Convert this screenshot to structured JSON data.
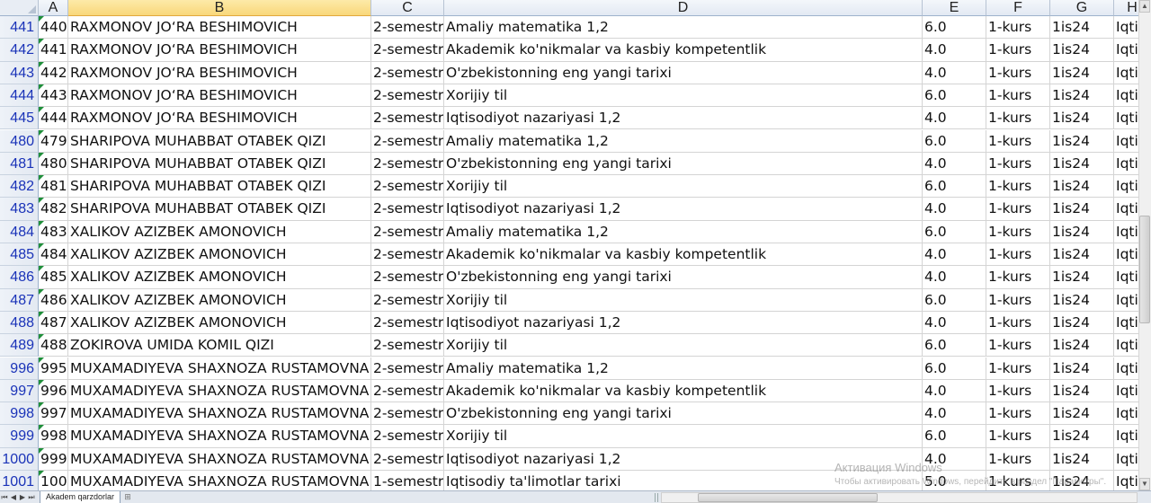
{
  "columns": [
    "A",
    "B",
    "C",
    "D",
    "E",
    "F",
    "G",
    "H"
  ],
  "selected_column": "B",
  "rows": [
    {
      "row": "441",
      "a": "440",
      "b": "RAXMONOV JO‘RA BESHIMOVICH",
      "c": "2-semestr",
      "d": "Amaliy matematika 1,2",
      "e": "6.0",
      "f": "1-kurs",
      "g": "1is24",
      "h": "Iqti"
    },
    {
      "row": "442",
      "a": "441",
      "b": "RAXMONOV JO‘RA BESHIMOVICH",
      "c": "2-semestr",
      "d": "Akademik ko'nikmalar va kasbiy kompetentlik",
      "e": "4.0",
      "f": "1-kurs",
      "g": "1is24",
      "h": "Iqti"
    },
    {
      "row": "443",
      "a": "442",
      "b": "RAXMONOV JO‘RA BESHIMOVICH",
      "c": "2-semestr",
      "d": "O'zbekistonning eng yangi tarixi",
      "e": "4.0",
      "f": "1-kurs",
      "g": "1is24",
      "h": "Iqti"
    },
    {
      "row": "444",
      "a": "443",
      "b": "RAXMONOV JO‘RA BESHIMOVICH",
      "c": "2-semestr",
      "d": "Xorijiy til",
      "e": "6.0",
      "f": "1-kurs",
      "g": "1is24",
      "h": "Iqti"
    },
    {
      "row": "445",
      "a": "444",
      "b": "RAXMONOV JO‘RA BESHIMOVICH",
      "c": "2-semestr",
      "d": "Iqtisodiyot nazariyasi 1,2",
      "e": "4.0",
      "f": "1-kurs",
      "g": "1is24",
      "h": "Iqti"
    },
    {
      "row": "480",
      "a": "479",
      "b": "SHARIPOVA MUHABBAT OTABEK QIZI",
      "c": "2-semestr",
      "d": "Amaliy matematika 1,2",
      "e": "6.0",
      "f": "1-kurs",
      "g": "1is24",
      "h": "Iqti"
    },
    {
      "row": "481",
      "a": "480",
      "b": "SHARIPOVA MUHABBAT OTABEK QIZI",
      "c": "2-semestr",
      "d": "O'zbekistonning eng yangi tarixi",
      "e": "4.0",
      "f": "1-kurs",
      "g": "1is24",
      "h": "Iqti"
    },
    {
      "row": "482",
      "a": "481",
      "b": "SHARIPOVA MUHABBAT OTABEK QIZI",
      "c": "2-semestr",
      "d": "Xorijiy til",
      "e": "6.0",
      "f": "1-kurs",
      "g": "1is24",
      "h": "Iqti"
    },
    {
      "row": "483",
      "a": "482",
      "b": "SHARIPOVA MUHABBAT OTABEK QIZI",
      "c": "2-semestr",
      "d": "Iqtisodiyot nazariyasi 1,2",
      "e": "4.0",
      "f": "1-kurs",
      "g": "1is24",
      "h": "Iqti"
    },
    {
      "row": "484",
      "a": "483",
      "b": "XALIKOV AZIZBEK AMONOVICH",
      "c": "2-semestr",
      "d": "Amaliy matematika 1,2",
      "e": "6.0",
      "f": "1-kurs",
      "g": "1is24",
      "h": "Iqti"
    },
    {
      "row": "485",
      "a": "484",
      "b": "XALIKOV AZIZBEK AMONOVICH",
      "c": "2-semestr",
      "d": "Akademik ko'nikmalar va kasbiy kompetentlik",
      "e": "4.0",
      "f": "1-kurs",
      "g": "1is24",
      "h": "Iqti"
    },
    {
      "row": "486",
      "a": "485",
      "b": "XALIKOV AZIZBEK AMONOVICH",
      "c": "2-semestr",
      "d": "O'zbekistonning eng yangi tarixi",
      "e": "4.0",
      "f": "1-kurs",
      "g": "1is24",
      "h": "Iqti"
    },
    {
      "row": "487",
      "a": "486",
      "b": "XALIKOV AZIZBEK AMONOVICH",
      "c": "2-semestr",
      "d": "Xorijiy til",
      "e": "6.0",
      "f": "1-kurs",
      "g": "1is24",
      "h": "Iqti"
    },
    {
      "row": "488",
      "a": "487",
      "b": "XALIKOV AZIZBEK AMONOVICH",
      "c": "2-semestr",
      "d": "Iqtisodiyot nazariyasi 1,2",
      "e": "4.0",
      "f": "1-kurs",
      "g": "1is24",
      "h": "Iqti"
    },
    {
      "row": "489",
      "a": "488",
      "b": "ZOKIROVA UMIDA KOMIL QIZI",
      "c": "2-semestr",
      "d": "Xorijiy til",
      "e": "6.0",
      "f": "1-kurs",
      "g": "1is24",
      "h": "Iqti"
    },
    {
      "row": "996",
      "a": "995",
      "b": "MUXAMADIYEVA SHAXNOZA RUSTAMOVNA",
      "c": "2-semestr",
      "d": "Amaliy matematika 1,2",
      "e": "6.0",
      "f": "1-kurs",
      "g": "1is24",
      "h": "Iqti"
    },
    {
      "row": "997",
      "a": "996",
      "b": "MUXAMADIYEVA SHAXNOZA RUSTAMOVNA",
      "c": "2-semestr",
      "d": "Akademik ko'nikmalar va kasbiy kompetentlik",
      "e": "4.0",
      "f": "1-kurs",
      "g": "1is24",
      "h": "Iqti"
    },
    {
      "row": "998",
      "a": "997",
      "b": "MUXAMADIYEVA SHAXNOZA RUSTAMOVNA",
      "c": "2-semestr",
      "d": "O'zbekistonning eng yangi tarixi",
      "e": "4.0",
      "f": "1-kurs",
      "g": "1is24",
      "h": "Iqti"
    },
    {
      "row": "999",
      "a": "998",
      "b": "MUXAMADIYEVA SHAXNOZA RUSTAMOVNA",
      "c": "2-semestr",
      "d": "Xorijiy til",
      "e": "6.0",
      "f": "1-kurs",
      "g": "1is24",
      "h": "Iqti"
    },
    {
      "row": "1000",
      "a": "999",
      "b": "MUXAMADIYEVA SHAXNOZA RUSTAMOVNA",
      "c": "2-semestr",
      "d": "Iqtisodiyot nazariyasi 1,2",
      "e": "4.0",
      "f": "1-kurs",
      "g": "1is24",
      "h": "Iqti"
    },
    {
      "row": "1001",
      "a": "100",
      "b": "MUXAMADIYEVA SHAXNOZA RUSTAMOVNA",
      "c": "1-semestr",
      "d": "Iqtisodiy ta'limotlar tarixi",
      "e": "5.0",
      "f": "1-kurs",
      "g": "1is24",
      "h": "Iqti"
    }
  ],
  "sheet_tab": "Akadem qarzdorlar",
  "watermark": {
    "title": "Активация Windows",
    "subtitle": "Чтобы активировать Windows, перейдите в раздел \"Параметры\"."
  },
  "colors": {
    "row_header_text": "#1a33b8",
    "selected_column_header": "#f9d77a",
    "error_indicator": "#1f8f3a"
  }
}
